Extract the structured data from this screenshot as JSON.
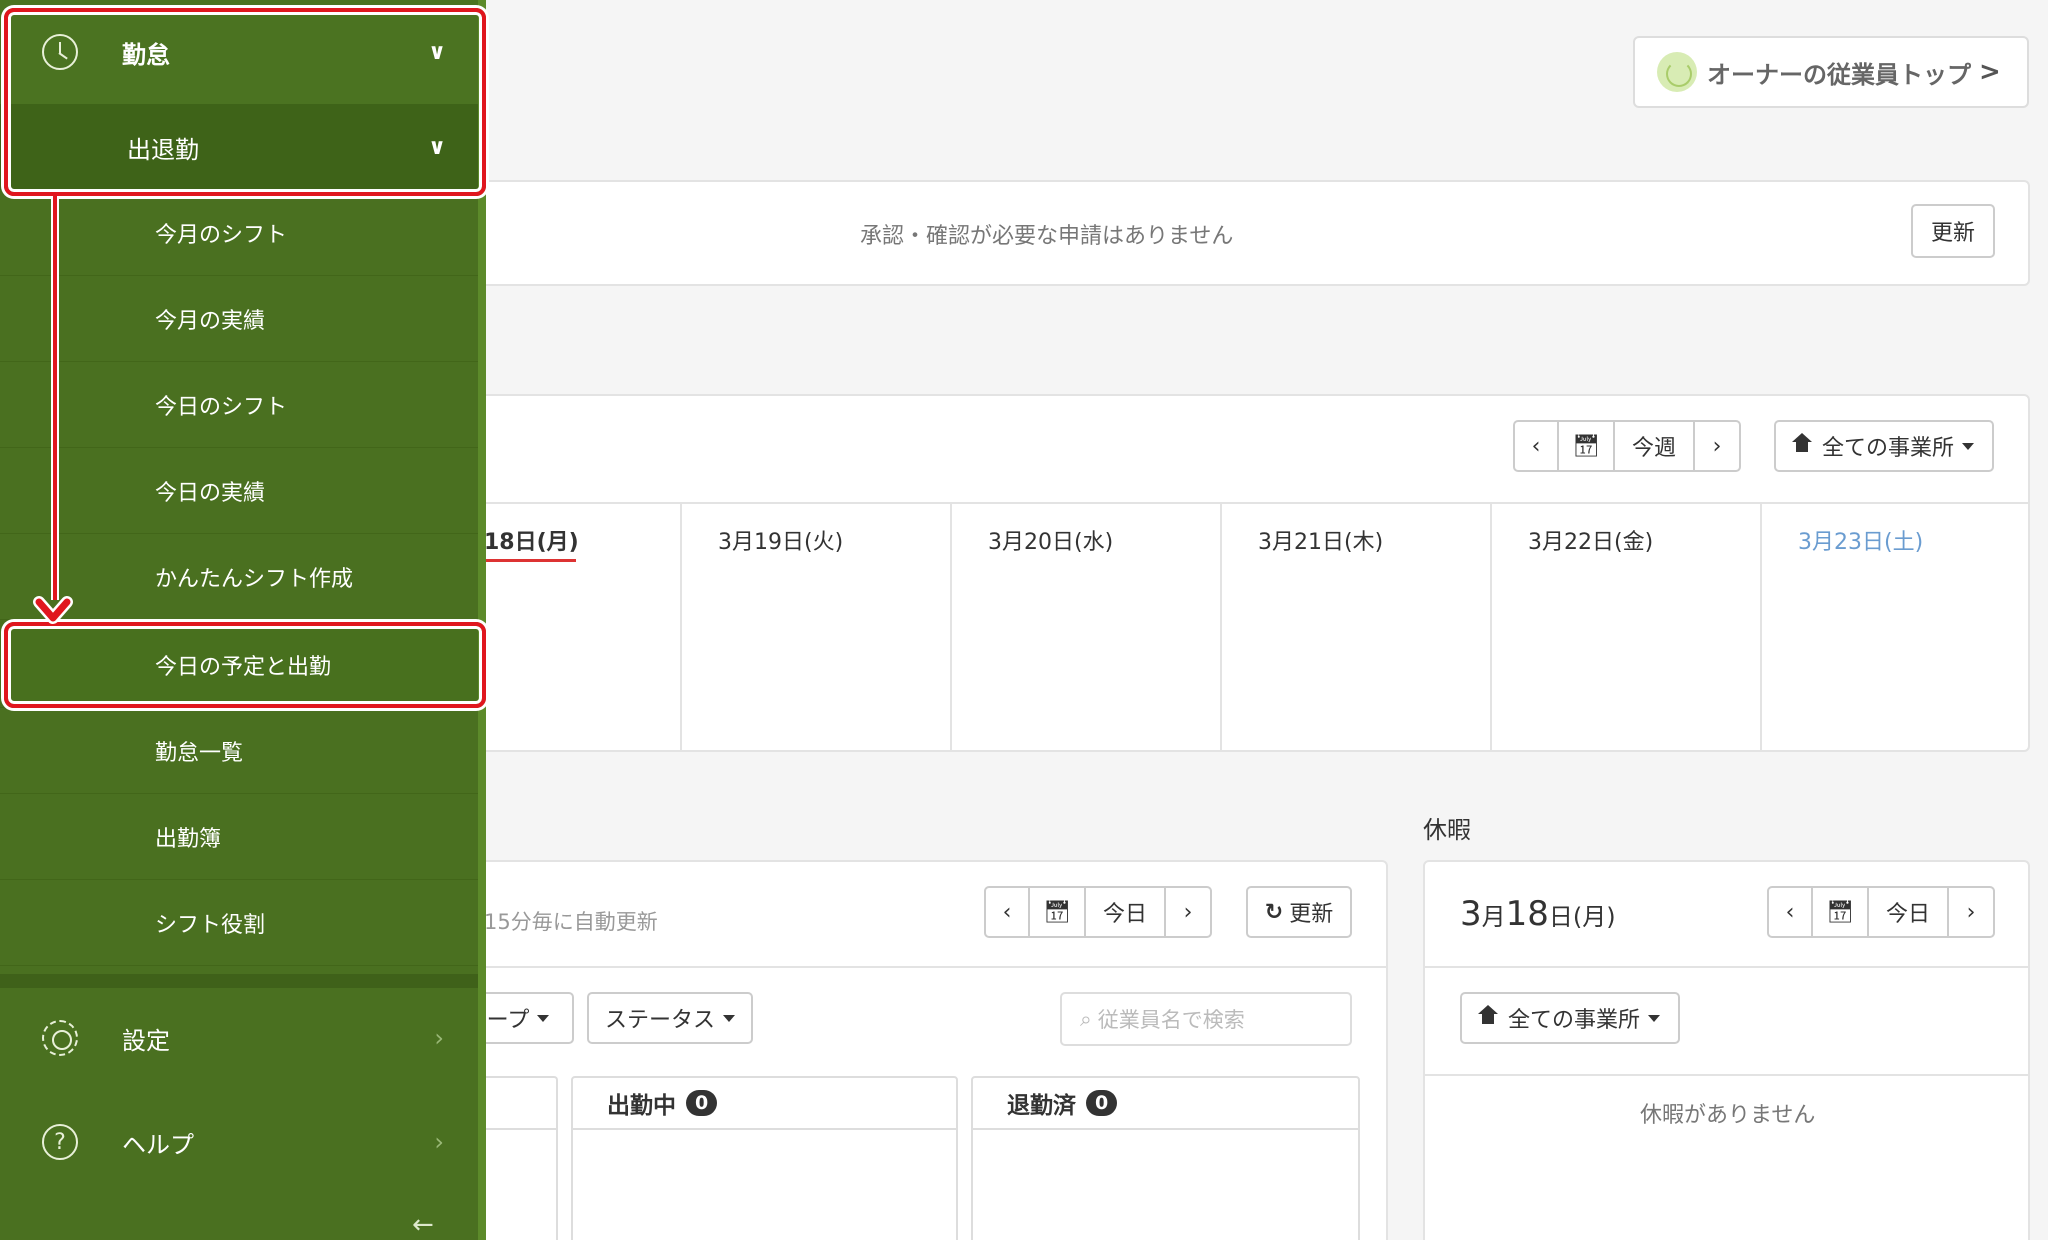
{
  "owner_button": {
    "label": "オーナーの従業員トップ",
    "chevron": ">"
  },
  "requests": {
    "empty_text": "承認・確認が必要な申請はありません",
    "refresh_label": "更新"
  },
  "week": {
    "prev": "‹",
    "next": "›",
    "calendar_icon": "calendar-icon",
    "today_label": "今週",
    "location_label": "全ての事業所",
    "days": [
      "18日(月)",
      "3月19日(火)",
      "3月20日(水)",
      "3月21日(木)",
      "3月22日(金)",
      "3月23日(土)"
    ]
  },
  "attendance": {
    "auto_refresh_text": "15分毎に自動更新",
    "prev": "‹",
    "next": "›",
    "today_label": "今日",
    "refresh_label": "更新",
    "group_label": "ループ",
    "status_label": "ステータス",
    "search_placeholder": "従業員名で検索",
    "columns": [
      {
        "title": "出勤中",
        "count": "0"
      },
      {
        "title": "退勤済",
        "count": "0"
      }
    ]
  },
  "vacation": {
    "title": "休暇",
    "date_month": "3",
    "date_month_unit": "月",
    "date_day": "18",
    "date_day_unit": "日",
    "date_weekday": "(月)",
    "prev": "‹",
    "next": "›",
    "today_label": "今日",
    "location_label": "全ての事業所",
    "empty_text": "休暇がありません"
  },
  "sidebar": {
    "top": {
      "label": "勤怠",
      "icon": "clock-icon"
    },
    "sub": {
      "label": "出退勤"
    },
    "items": [
      "今月のシフト",
      "今月の実績",
      "今日のシフト",
      "今日の実績",
      "かんたんシフト作成",
      "今日の予定と出勤",
      "勤怠一覧",
      "出勤簿",
      "シフト役割"
    ],
    "settings": {
      "label": "設定",
      "icon": "gear-icon"
    },
    "help": {
      "label": "ヘルプ",
      "icon": "help-icon"
    }
  },
  "colors": {
    "sidebar": "#4a7020",
    "highlight": "#e0161e",
    "saturday": "#6a9cd0"
  }
}
